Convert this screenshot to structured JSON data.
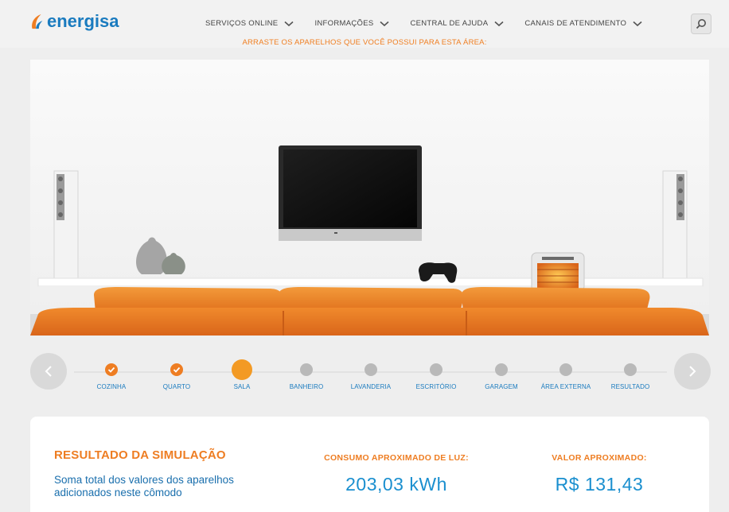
{
  "header": {
    "logo_text": "energisa",
    "nav": [
      {
        "label": "SERVIÇOS ONLINE"
      },
      {
        "label": "INFORMAÇÕES"
      },
      {
        "label": "CENTRAL DE AJUDA"
      },
      {
        "label": "CANAIS DE ATENDIMENTO"
      }
    ],
    "search_icon": "search-icon"
  },
  "instruction": "ARRASTE OS APARELHOS QUE VOCÊ POSSUI PARA ESTA ÁREA:",
  "room": {
    "appliances": [
      "tv",
      "speaker",
      "speaker",
      "game-controller",
      "heater",
      "vases",
      "sofa"
    ]
  },
  "steps": {
    "items": [
      {
        "label": "COZINHA",
        "state": "done"
      },
      {
        "label": "QUARTO",
        "state": "done"
      },
      {
        "label": "SALA",
        "state": "active"
      },
      {
        "label": "BANHEIRO",
        "state": "pending"
      },
      {
        "label": "LAVANDERIA",
        "state": "pending"
      },
      {
        "label": "ESCRITÓRIO",
        "state": "pending"
      },
      {
        "label": "GARAGEM",
        "state": "pending"
      },
      {
        "label": "ÁREA EXTERNA",
        "state": "pending"
      },
      {
        "label": "RESULTADO",
        "state": "pending"
      }
    ]
  },
  "result": {
    "title": "RESULTADO DA SIMULAÇÃO",
    "description": "Soma total dos valores dos aparelhos adicionados neste cômodo",
    "consumption_label": "CONSUMO APROXIMADO DE LUZ:",
    "consumption_value": "203,03 kWh",
    "value_label": "VALOR APROXIMADO:",
    "value_value": "R$ 131,43"
  },
  "colors": {
    "brand_blue": "#1a7bbf",
    "accent_orange": "#ee7d22",
    "active_orange": "#f39a24",
    "pending_gray": "#b9b9b9"
  }
}
